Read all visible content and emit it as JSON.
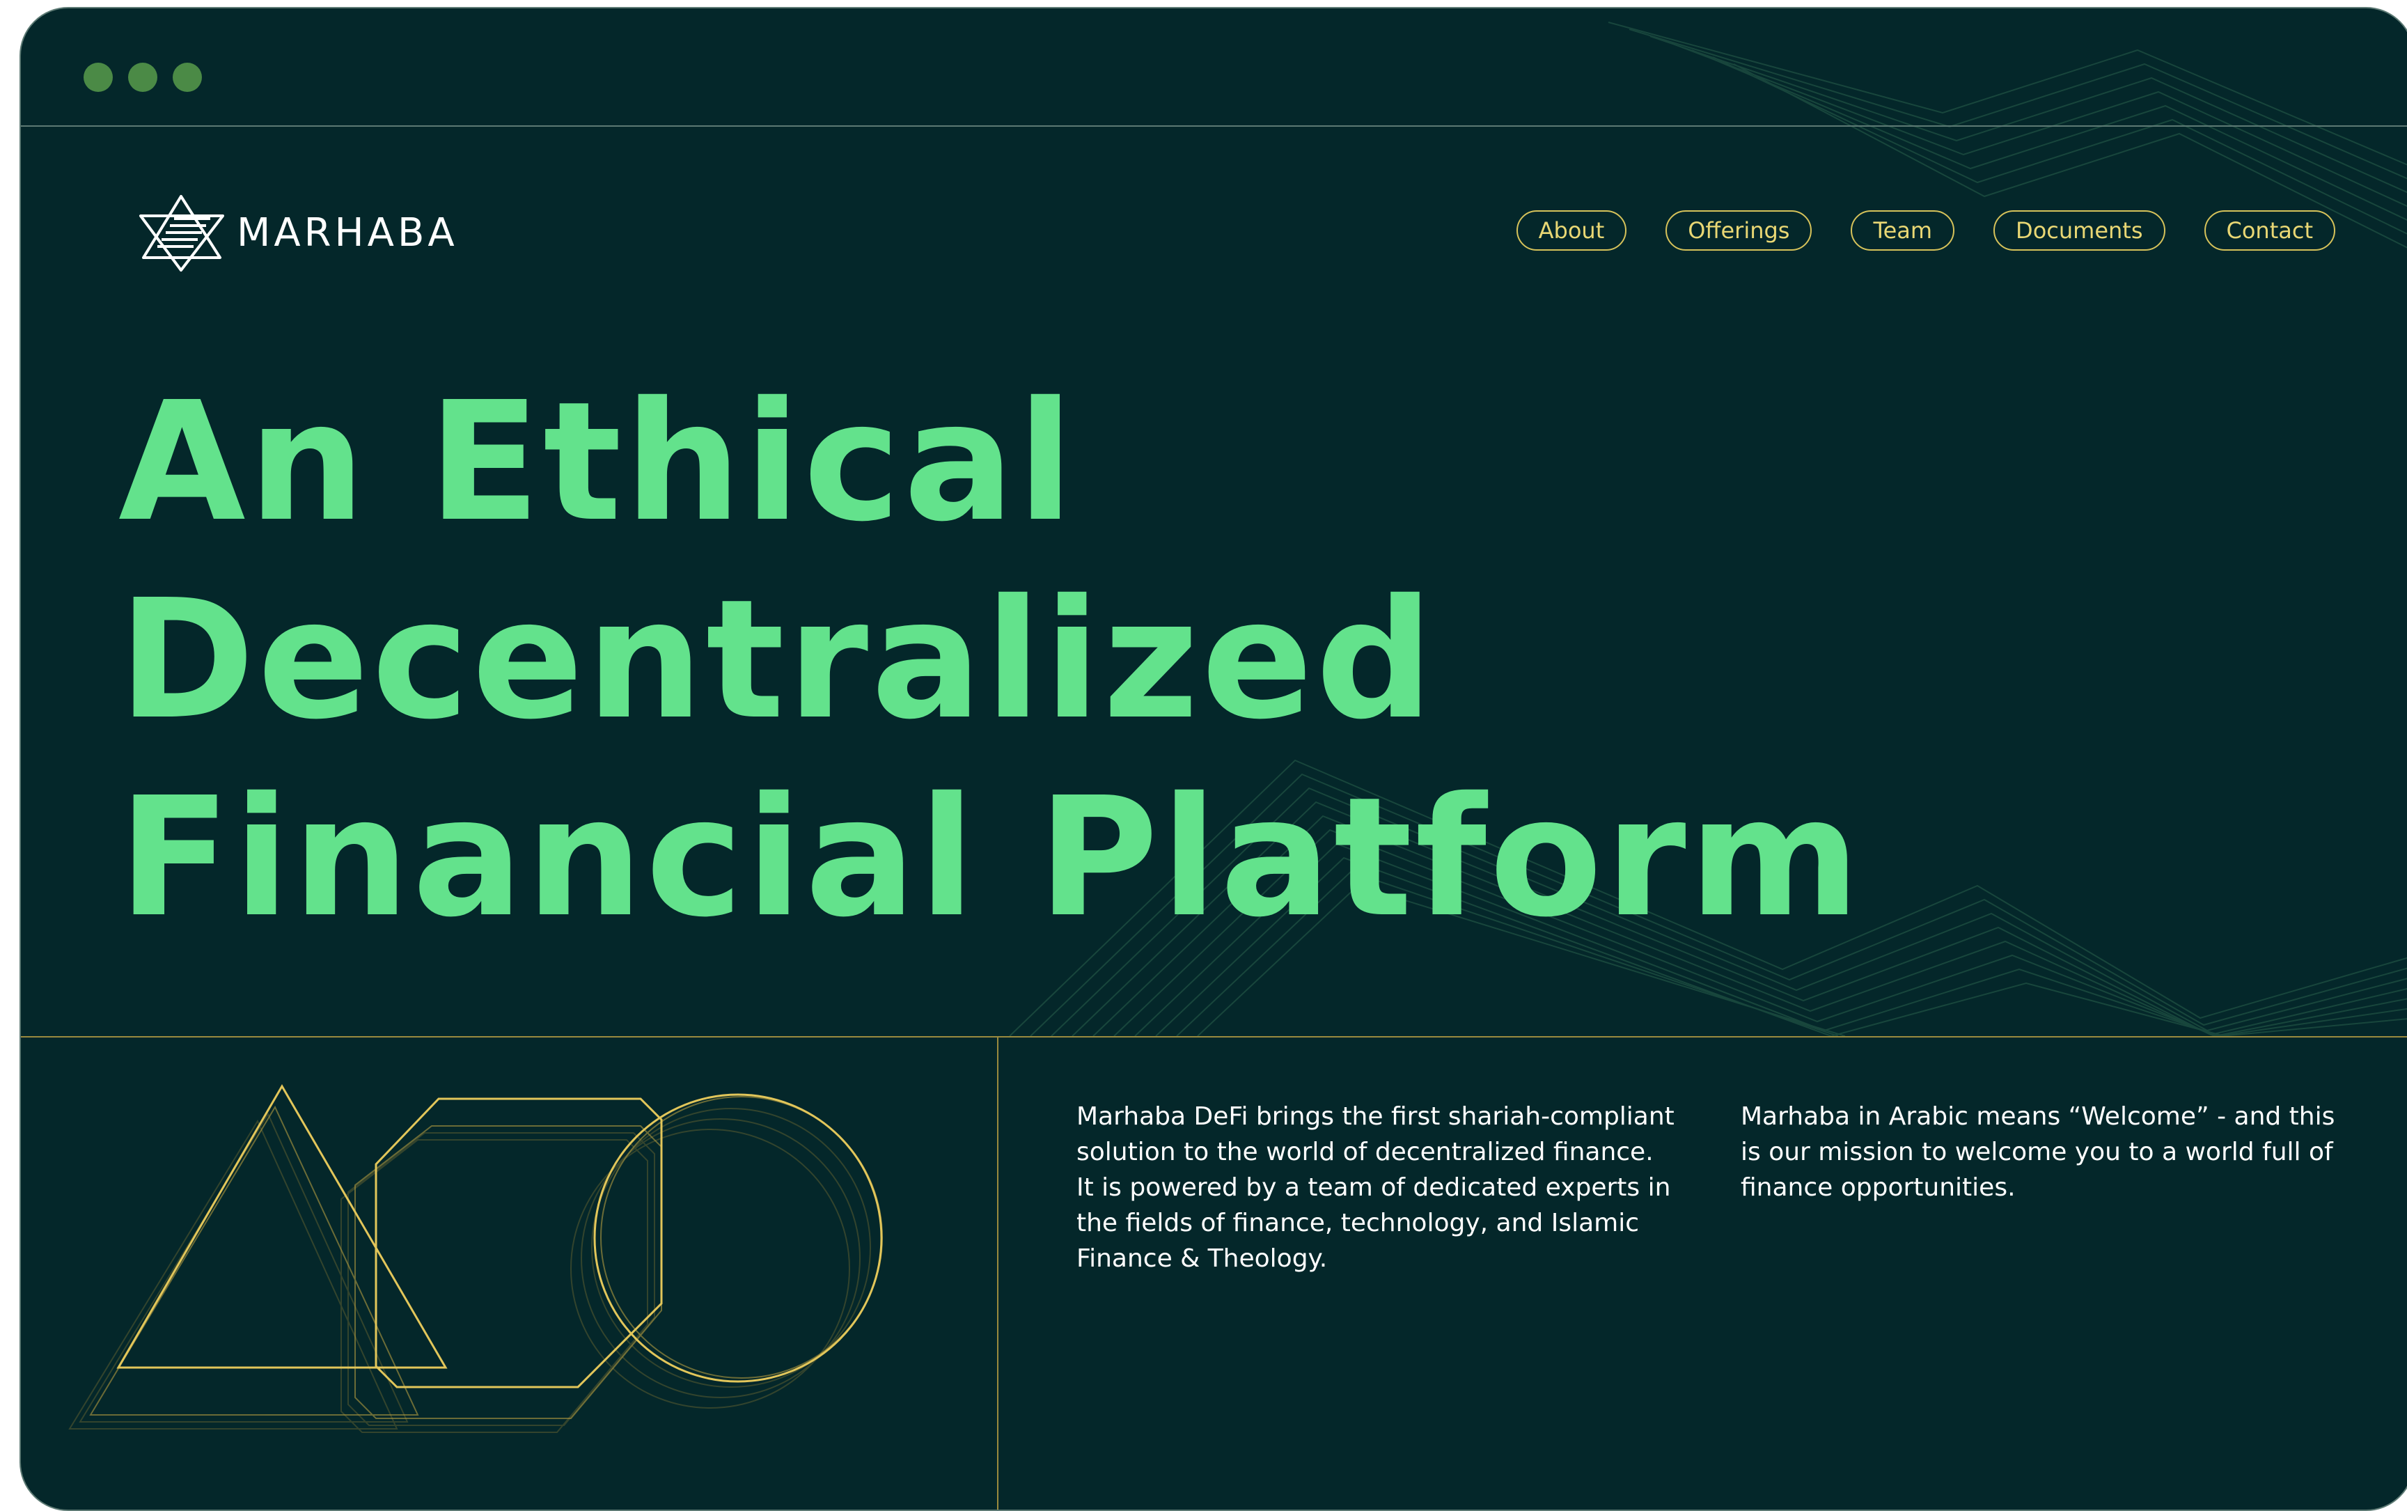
{
  "window": {
    "traffic_lights": [
      "close",
      "minimize",
      "maximize"
    ],
    "traffic_light_color": "#4b8a46"
  },
  "brand": {
    "name": "MARHABA",
    "logo_icon": "star-triangle-logo",
    "text_color": "#ffffff"
  },
  "nav": {
    "items": [
      {
        "label": "About"
      },
      {
        "label": "Offerings"
      },
      {
        "label": "Team"
      },
      {
        "label": "Documents"
      },
      {
        "label": "Contact"
      }
    ],
    "border_color": "#d6c25a"
  },
  "hero": {
    "lines": [
      "An Ethical",
      "Decentralized",
      "Financial Platform"
    ],
    "color": "#63e28c"
  },
  "about": {
    "paragraph_1": "Marhaba DeFi brings the first shariah-compliant solution to the world of decentralized finance. It is powered by a team of dedicated experts in the fields of finance, technology, and Islamic Finance & Theology.",
    "paragraph_2": "Marhaba in Arabic means “Welcome” - and this is our mission to welcome you to a world full of finance opportunities."
  },
  "illustration": {
    "shapes": [
      "triangle-outline-icon",
      "octagon-outline-icon",
      "circle-outline-icon"
    ],
    "stroke_color": "#e2c65a"
  },
  "theme": {
    "background": "#04272a",
    "accent_gold": "#d6c25a",
    "accent_green": "#63e28c"
  }
}
